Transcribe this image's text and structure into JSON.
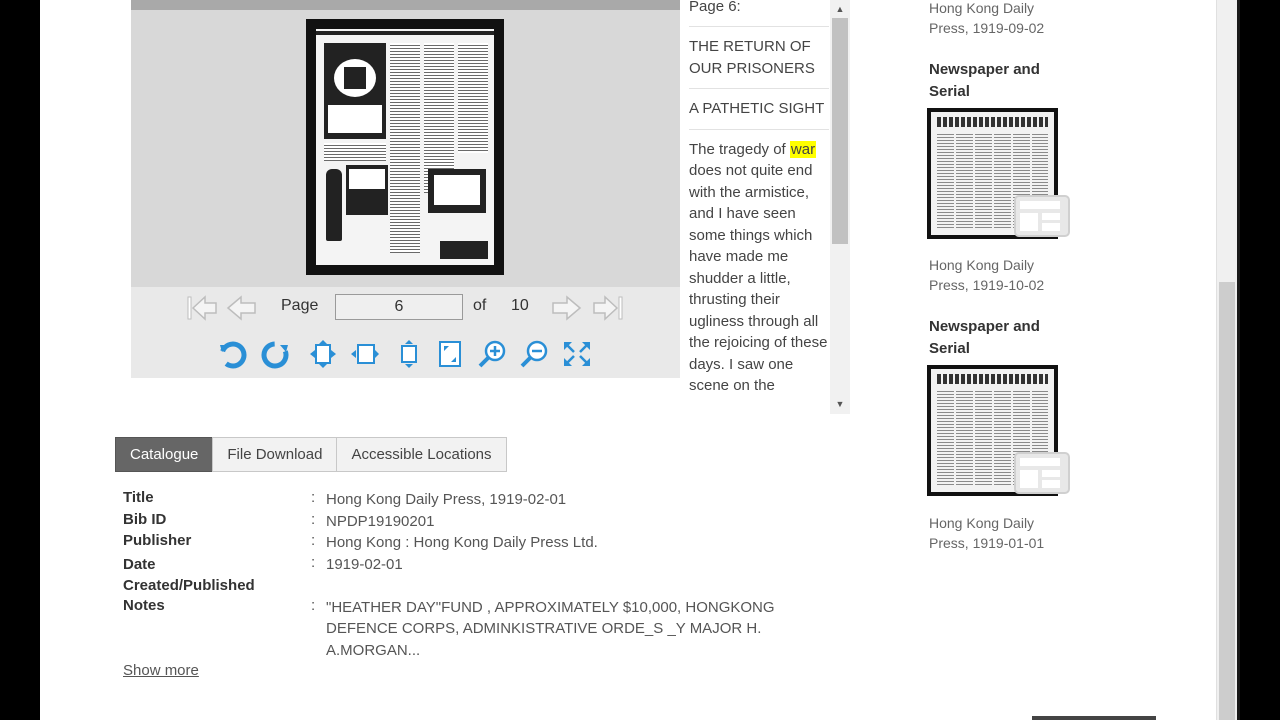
{
  "viewer": {
    "nav": {
      "page_label": "Page",
      "current_page": "6",
      "of_label": "of",
      "total_pages": "10"
    }
  },
  "ocr": {
    "page_heading": "Page 6:",
    "blocks": [
      "THE RETURN OF OUR PRISONERS",
      "A PATHETIC SIGHT"
    ],
    "body_before": "The tragedy of ",
    "highlight": "war",
    "body_after": " does not quite end with the armistice, and I have seen some things which have made me shudder a little, thrusting their ugliness through all the rejoicing of these days. I saw one scene on the"
  },
  "tabs": [
    "Catalogue",
    "File Download",
    "Accessible Locations"
  ],
  "details": [
    {
      "key": "Title",
      "value": "Hong Kong Daily Press, 1919-02-01"
    },
    {
      "key": "Bib ID",
      "value": "NPDP19190201"
    },
    {
      "key": "Publisher",
      "value": "Hong Kong : Hong Kong Daily Press Ltd."
    },
    {
      "key": "Date Created/Published",
      "value": "1919-02-01"
    },
    {
      "key": "Notes",
      "value": "\"HEATHER DAY\"FUND , APPROXIMATELY $10,000, HONGKONG DEFENCE CORPS, ADMINKISTRATIVE ORDE_S _Y MAJOR H. A.MORGAN..."
    }
  ],
  "show_more": "Show more",
  "related": {
    "top_caption": "Hong Kong Daily Press, 1919-09-02",
    "items": [
      {
        "heading": "Newspaper and Serial",
        "caption": "Hong Kong Daily Press, 1919-10-02"
      },
      {
        "heading": "Newspaper and Serial",
        "caption": "Hong Kong Daily Press, 1919-01-01"
      }
    ]
  },
  "colors": {
    "accent_tab": "#666666",
    "highlight": "#ffff00",
    "icon_blue": "#2a8fd6"
  }
}
